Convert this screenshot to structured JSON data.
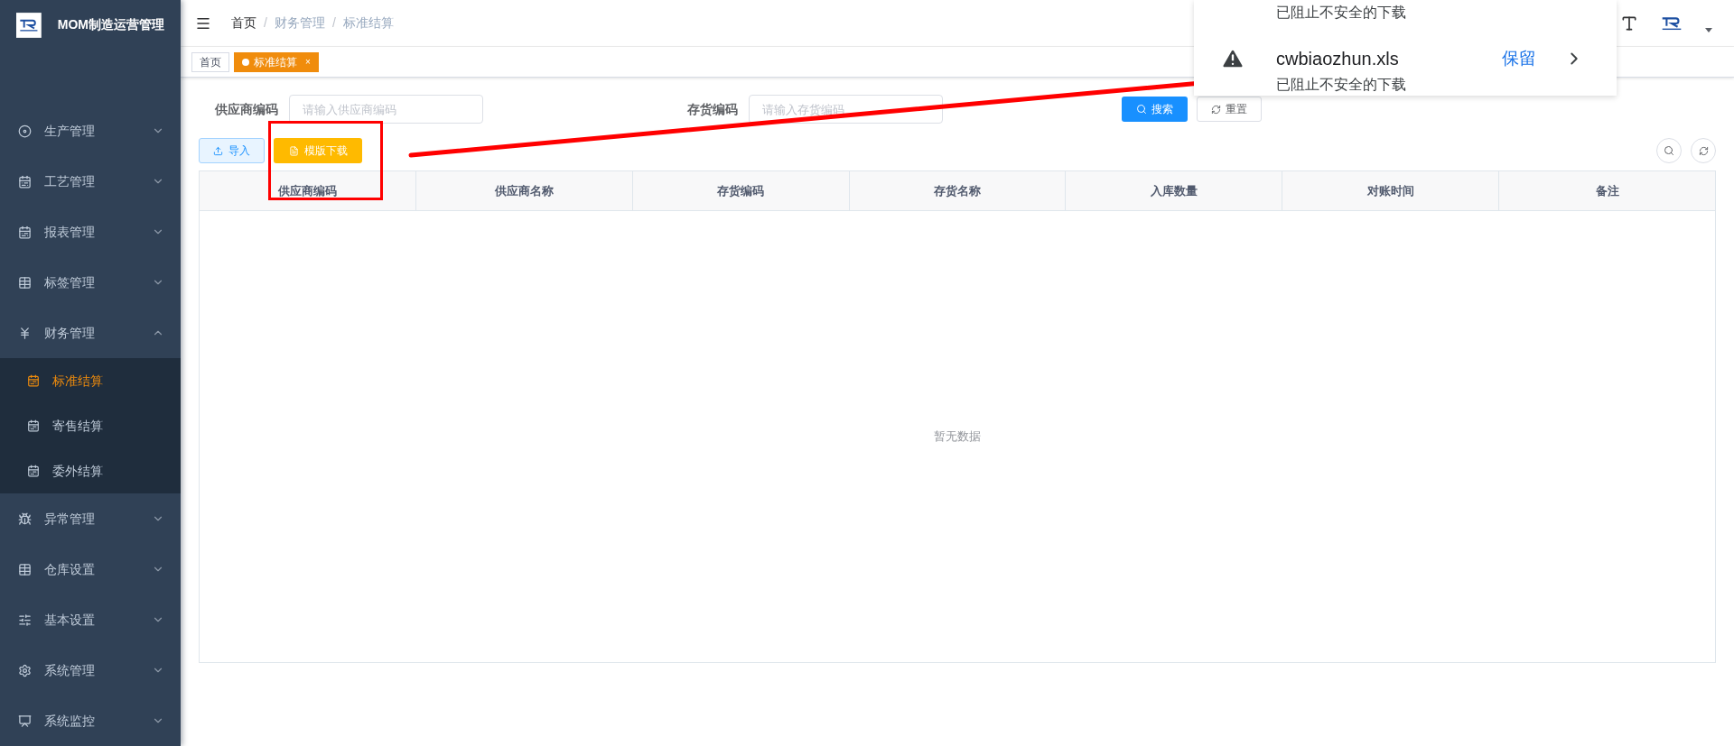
{
  "app": {
    "title": "MOM制造运营管理"
  },
  "sidebar": {
    "items": [
      {
        "label": "生产管理",
        "kind": "disc",
        "expanded": false,
        "selected": false
      },
      {
        "label": "工艺管理",
        "kind": "calendar",
        "expanded": false,
        "selected": false
      },
      {
        "label": "报表管理",
        "kind": "calendar",
        "expanded": false,
        "selected": false
      },
      {
        "label": "标签管理",
        "kind": "table",
        "expanded": false,
        "selected": false
      },
      {
        "label": "财务管理",
        "kind": "yen",
        "expanded": true,
        "selected": false,
        "children": [
          {
            "label": "标准结算",
            "kind": "calendar",
            "selected": true
          },
          {
            "label": "寄售结算",
            "kind": "calendar",
            "selected": false
          },
          {
            "label": "委外结算",
            "kind": "calendar",
            "selected": false
          }
        ]
      },
      {
        "label": "异常管理",
        "kind": "bug",
        "expanded": false,
        "selected": false
      },
      {
        "label": "仓库设置",
        "kind": "table",
        "expanded": false,
        "selected": false
      },
      {
        "label": "基本设置",
        "kind": "sliders",
        "expanded": false,
        "selected": false
      },
      {
        "label": "系统管理",
        "kind": "gear",
        "expanded": false,
        "selected": false
      },
      {
        "label": "系统监控",
        "kind": "monitor",
        "expanded": false,
        "selected": false
      }
    ]
  },
  "breadcrumb": {
    "items": [
      "首页",
      "财务管理",
      "标准结算"
    ],
    "separators": [
      "/",
      "/"
    ]
  },
  "tabs": [
    {
      "label": "首页",
      "selected": false
    },
    {
      "label": "标准结算",
      "selected": true,
      "close": "×"
    }
  ],
  "filters": [
    {
      "label": "供应商编码",
      "placeholder": "请输入供应商编码"
    },
    {
      "label": "存货编码",
      "placeholder": "请输入存货编码"
    }
  ],
  "search_button": "搜索",
  "reset_button": "重置",
  "toolbar": [
    {
      "label": "导入",
      "kind": "import"
    },
    {
      "label": "模版下载",
      "kind": "download"
    }
  ],
  "table": {
    "columns": [
      "供应商编码",
      "供应商名称",
      "存货编码",
      "存货名称",
      "入库数量",
      "对账时间",
      "备注"
    ],
    "empty_text": "暂无数据"
  },
  "download_panel": {
    "previous_status": "已阻止不安全的下载",
    "file": {
      "name": "cwbiaozhun.xls",
      "action": "保留",
      "status": "已阻止不安全的下载"
    }
  }
}
